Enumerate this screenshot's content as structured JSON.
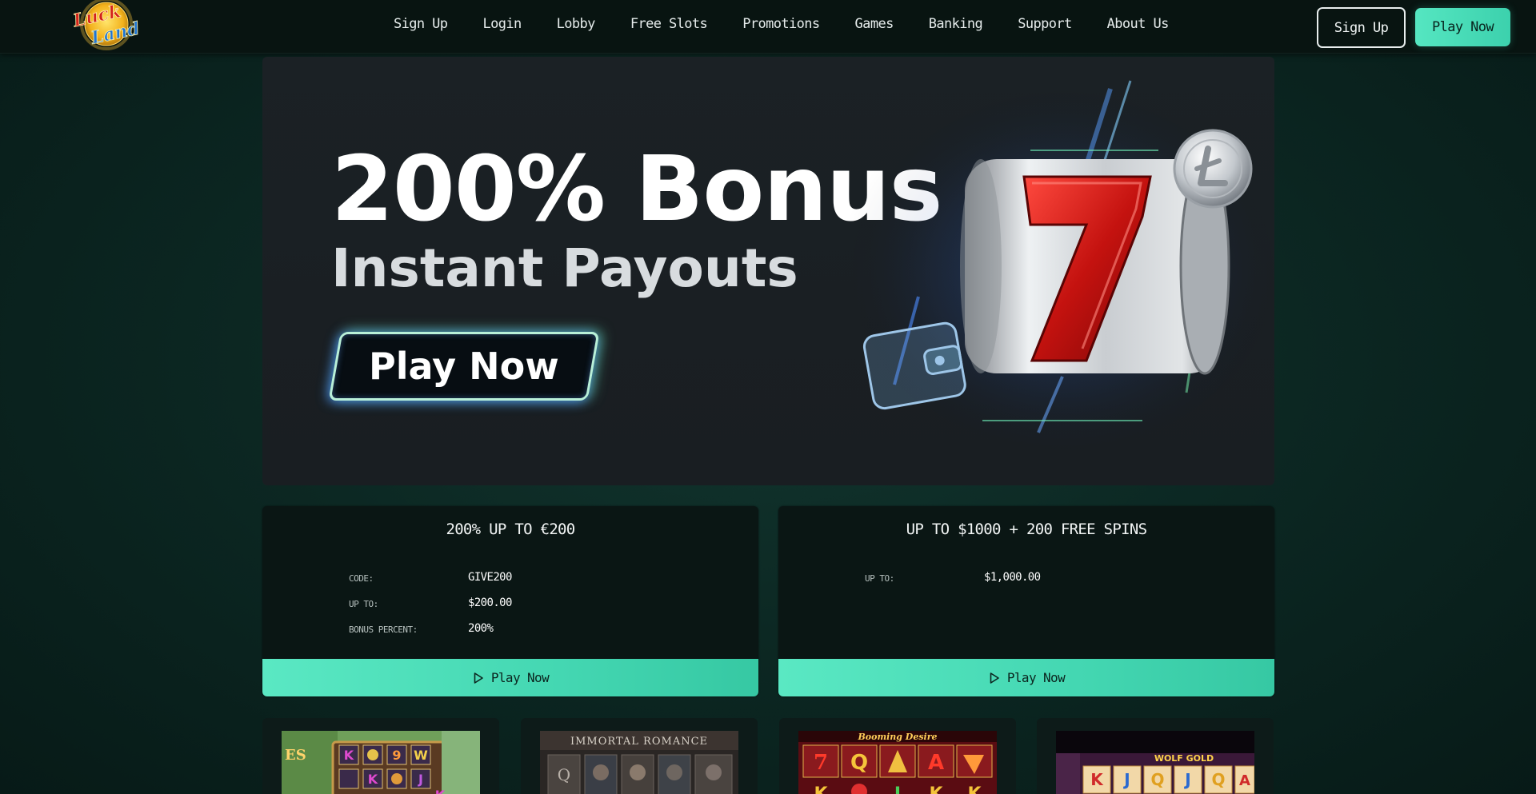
{
  "header": {
    "logo": {
      "line1": "Luck",
      "line2": "Land",
      "icon": "lucky-land-logo"
    },
    "nav": [
      {
        "label": "Sign Up"
      },
      {
        "label": "Login"
      },
      {
        "label": "Lobby"
      },
      {
        "label": "Free Slots"
      },
      {
        "label": "Promotions"
      },
      {
        "label": "Games"
      },
      {
        "label": "Banking"
      },
      {
        "label": "Support"
      },
      {
        "label": "About Us"
      }
    ],
    "signup_label": "Sign Up",
    "play_label": "Play Now"
  },
  "hero": {
    "title": "200% Bonus",
    "subtitle": "Instant Payouts",
    "cta_label": "Play Now",
    "art": {
      "icons": [
        "slot-reel-seven-icon",
        "litecoin-coin-icon",
        "wallet-icon"
      ]
    }
  },
  "bonuses": [
    {
      "title": "200% UP TO €200",
      "rows": [
        {
          "key": "CODE:",
          "value": "GIVE200"
        },
        {
          "key": "UP TO:",
          "value": "$200.00"
        },
        {
          "key": "BONUS PERCENT:",
          "value": "200%"
        }
      ],
      "play_label": "Play Now"
    },
    {
      "title": "UP TO $1000 + 200 FREE SPINS",
      "rows": [
        {
          "key": "UP TO:",
          "value": "$1,000.00"
        }
      ],
      "play_label": "Play Now"
    }
  ],
  "games": [
    {
      "caption": "ES",
      "thumb_text": [
        "K",
        "9",
        "W",
        "J",
        "K"
      ]
    },
    {
      "caption": "IMMORTAL ROMANCE",
      "thumb_text": [
        "Q"
      ]
    },
    {
      "caption": "Booming Desire",
      "thumb_text": [
        "7",
        "Q",
        "A",
        "K",
        "J",
        "K"
      ]
    },
    {
      "caption": "WOLF GOLD",
      "thumb_text": [
        "K",
        "J",
        "Q",
        "J",
        "Q",
        "A"
      ]
    }
  ],
  "colors": {
    "accent": "#4bdfb9",
    "header_bg": "#081411",
    "page_bg": "#0c2823",
    "hero_bg": "#1b2125",
    "card_bg": "#0a1614"
  }
}
